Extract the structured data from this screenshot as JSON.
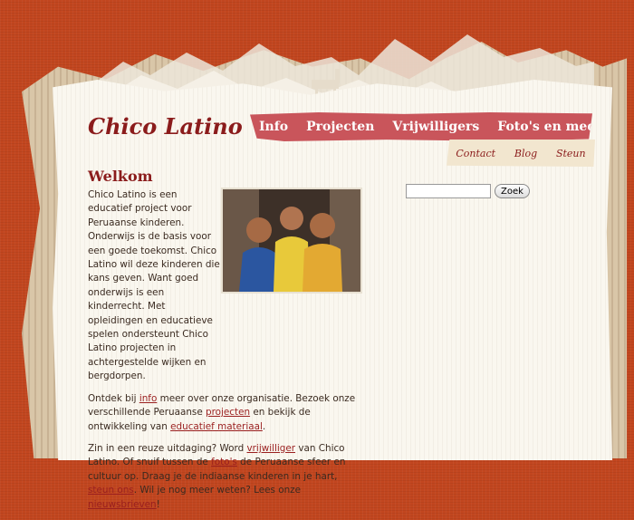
{
  "site": {
    "logo": "Chico Latino"
  },
  "nav": {
    "main": [
      "Info",
      "Projecten",
      "Vrijwilligers",
      "Foto's en media"
    ],
    "sub": [
      "Contact",
      "Blog",
      "Steun"
    ]
  },
  "search": {
    "button": "Zoek",
    "value": ""
  },
  "content": {
    "heading": "Welkom",
    "intro": "Chico Latino is een educatief project voor Peruaanse kinderen. Onderwijs is de basis voor een goede toekomst. Chico Latino wil deze kinderen die kans geven. Want goed onderwijs is een kinderrecht. Met opleidingen en educatieve spelen ondersteunt Chico Latino projecten in achtergestelde wijken en bergdorpen.",
    "p2": {
      "t1": "Ontdek bij ",
      "l1": "info",
      "t2": " meer over onze organisatie. Bezoek onze verschillende Peruaanse ",
      "l2": "projecten",
      "t3": " en bekijk de ontwikkeling van ",
      "l3": "educatief materiaal",
      "t4": "."
    },
    "p3": {
      "t1": "Zin in een reuze uitdaging? Word ",
      "l1": "vrijwilliger",
      "t2": " van Chico Latino. Of snuif tussen de ",
      "l2": "foto's",
      "t3": " de Peruaanse sfeer en cultuur op. Draag je de indiaanse kinderen in je hart, ",
      "l3": "steun ons",
      "t4": ". Wil je nog meer weten? Lees onze ",
      "l4": "nieuwsbrieven",
      "t5": "!"
    }
  },
  "colors": {
    "brand": "#8b1c1c",
    "nav_bg": "#c9555b",
    "page_bg": "#c2461f",
    "paper": "#faf7ef"
  },
  "icons": {
    "photo": "children-photo"
  }
}
